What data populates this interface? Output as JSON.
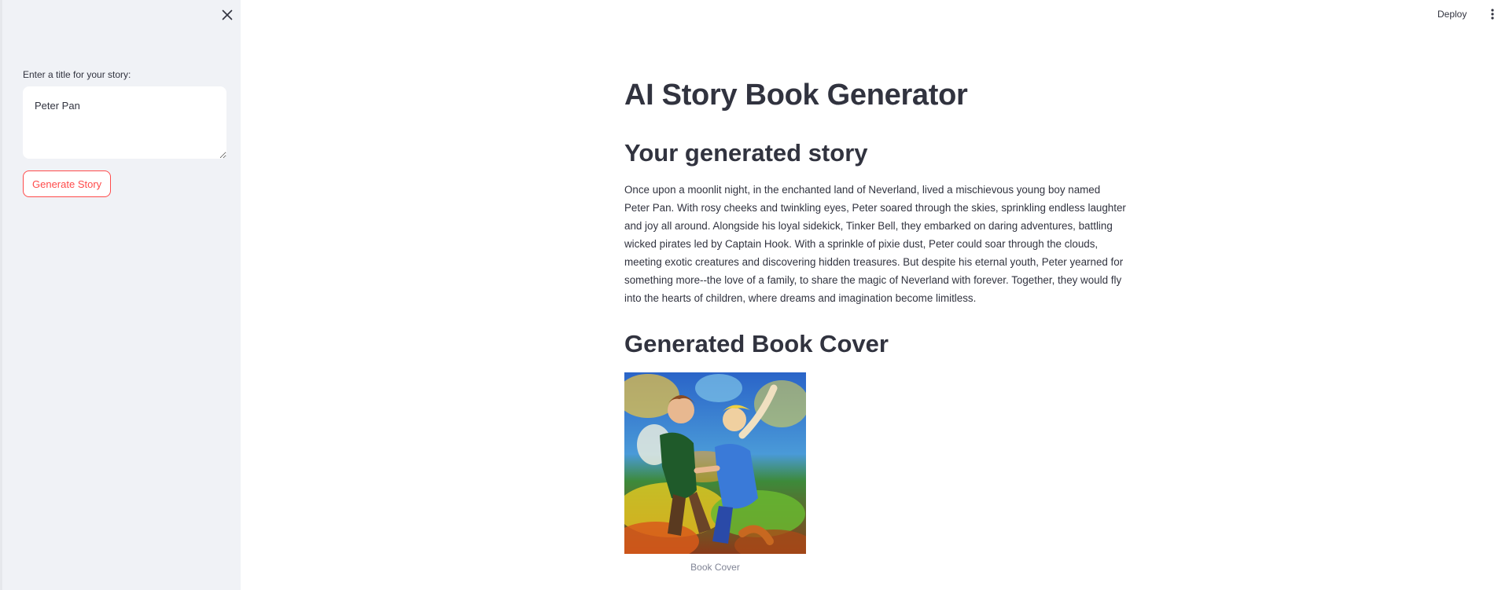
{
  "sidebar": {
    "input_label": "Enter a title for your story:",
    "title_value": "Peter Pan",
    "generate_label": "Generate Story"
  },
  "header": {
    "deploy_label": "Deploy"
  },
  "main": {
    "title": "AI Story Book Generator",
    "story_heading": "Your generated story",
    "story_text": "Once upon a moonlit night, in the enchanted land of Neverland, lived a mischievous young boy named Peter Pan. With rosy cheeks and twinkling eyes, Peter soared through the skies, sprinkling endless laughter and joy all around. Alongside his loyal sidekick, Tinker Bell, they embarked on daring adventures, battling wicked pirates led by Captain Hook. With a sprinkle of pixie dust, Peter could soar through the clouds, meeting exotic creatures and discovering hidden treasures. But despite his eternal youth, Peter yearned for something more--the love of a family, to share the magic of Neverland with forever. Together, they would fly into the hearts of children, where dreams and imagination become limitless.",
    "cover_heading": "Generated Book Cover",
    "cover_caption": "Book Cover"
  },
  "colors": {
    "accent": "#ff4b4b",
    "sidebar_bg": "#f0f2f6",
    "text": "#31333f",
    "caption": "#808495"
  },
  "icons": {
    "close": "close-icon",
    "menu": "kebab-menu-icon"
  }
}
